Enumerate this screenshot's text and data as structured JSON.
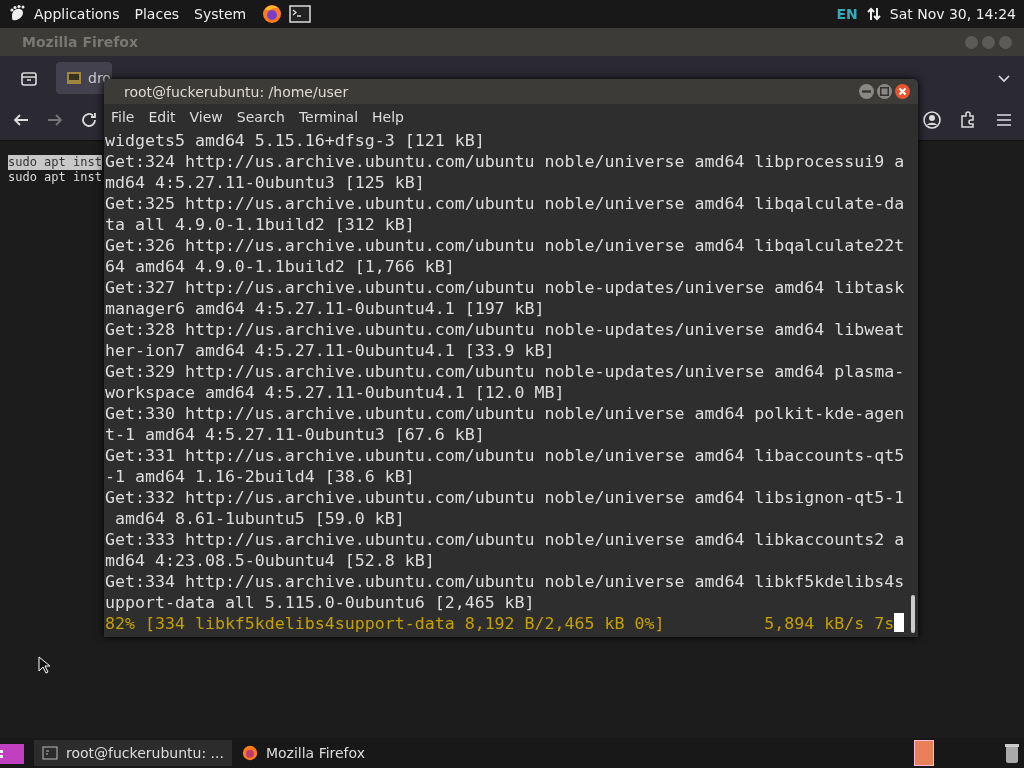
{
  "top_panel": {
    "menus": [
      "Applications",
      "Places",
      "System"
    ],
    "keyboard_layout": "EN",
    "clock": "Sat Nov 30, 14:24"
  },
  "browser": {
    "title": "Mozilla Firefox",
    "tab": {
      "label": "dro",
      "selected": true
    },
    "page_lines": [
      {
        "text": "sudo apt inst",
        "highlighted": true
      },
      {
        "text": "sudo apt inst",
        "highlighted": false
      }
    ]
  },
  "terminal": {
    "title": "root@fuckerubuntu: /home/user",
    "menu": [
      "File",
      "Edit",
      "View",
      "Search",
      "Terminal",
      "Help"
    ],
    "lines": [
      {
        "kind": "output",
        "text": "widgets5 amd64 5.15.16+dfsg-3 [121 kB]"
      },
      {
        "kind": "output",
        "text": "Get:324 http://us.archive.ubuntu.com/ubuntu noble/universe amd64 libprocessui9 a"
      },
      {
        "kind": "output",
        "text": "md64 4:5.27.11-0ubuntu3 [125 kB]"
      },
      {
        "kind": "output",
        "text": "Get:325 http://us.archive.ubuntu.com/ubuntu noble/universe amd64 libqalculate-da"
      },
      {
        "kind": "output",
        "text": "ta all 4.9.0-1.1build2 [312 kB]"
      },
      {
        "kind": "output",
        "text": "Get:326 http://us.archive.ubuntu.com/ubuntu noble/universe amd64 libqalculate22t"
      },
      {
        "kind": "output",
        "text": "64 amd64 4.9.0-1.1build2 [1,766 kB]"
      },
      {
        "kind": "output",
        "text": "Get:327 http://us.archive.ubuntu.com/ubuntu noble-updates/universe amd64 libtask"
      },
      {
        "kind": "output",
        "text": "manager6 amd64 4:5.27.11-0ubuntu4.1 [197 kB]"
      },
      {
        "kind": "output",
        "text": "Get:328 http://us.archive.ubuntu.com/ubuntu noble-updates/universe amd64 libweat"
      },
      {
        "kind": "output",
        "text": "her-ion7 amd64 4:5.27.11-0ubuntu4.1 [33.9 kB]"
      },
      {
        "kind": "output",
        "text": "Get:329 http://us.archive.ubuntu.com/ubuntu noble-updates/universe amd64 plasma-"
      },
      {
        "kind": "output",
        "text": "workspace amd64 4:5.27.11-0ubuntu4.1 [12.0 MB]"
      },
      {
        "kind": "output",
        "text": "Get:330 http://us.archive.ubuntu.com/ubuntu noble/universe amd64 polkit-kde-agen"
      },
      {
        "kind": "output",
        "text": "t-1 amd64 4:5.27.11-0ubuntu3 [67.6 kB]"
      },
      {
        "kind": "output",
        "text": "Get:331 http://us.archive.ubuntu.com/ubuntu noble/universe amd64 libaccounts-qt5"
      },
      {
        "kind": "output",
        "text": "-1 amd64 1.16-2build4 [38.6 kB]"
      },
      {
        "kind": "output",
        "text": "Get:332 http://us.archive.ubuntu.com/ubuntu noble/universe amd64 libsignon-qt5-1"
      },
      {
        "kind": "output",
        "text": " amd64 8.61-1ubuntu5 [59.0 kB]"
      },
      {
        "kind": "output",
        "text": "Get:333 http://us.archive.ubuntu.com/ubuntu noble/universe amd64 libkaccounts2 a"
      },
      {
        "kind": "output",
        "text": "md64 4:23.08.5-0ubuntu4 [52.8 kB]"
      },
      {
        "kind": "output",
        "text": "Get:334 http://us.archive.ubuntu.com/ubuntu noble/universe amd64 libkf5kdelibs4s"
      },
      {
        "kind": "output",
        "text": "upport-data all 5.115.0-0ubuntu6 [2,465 kB]"
      },
      {
        "kind": "progress",
        "text": "82% [334 libkf5kdelibs4support-data 8,192 B/2,465 kB 0%]          5,894 kB/s 7s"
      }
    ]
  },
  "taskbar": {
    "items": [
      {
        "kind": "terminal",
        "label": "root@fuckerubuntu: ...",
        "selected": true
      },
      {
        "kind": "browser",
        "label": "Mozilla Firefox",
        "selected": false
      }
    ]
  }
}
